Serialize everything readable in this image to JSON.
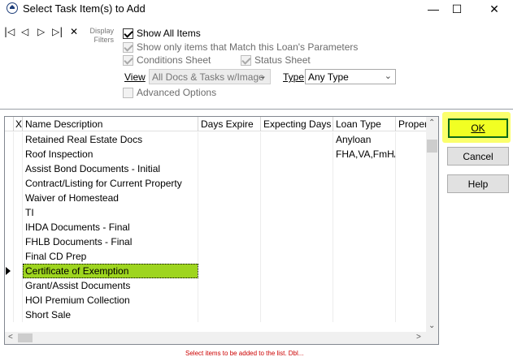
{
  "window": {
    "title": "Select Task Item(s) to Add",
    "minimize_glyph": "—",
    "maximize_glyph": "☐",
    "close_glyph": "✕"
  },
  "nav": {
    "first": "|◁",
    "prev": "◁",
    "next": "▷",
    "last": "▷|",
    "delete": "✕"
  },
  "filters": {
    "label": "Display Filters",
    "show_all": {
      "label": "Show All Items",
      "checked": true
    },
    "match_loan": {
      "label": "Show only items that Match this Loan's Parameters",
      "checked": true
    },
    "conditions_sheet": {
      "label": "Conditions Sheet",
      "checked": true
    },
    "status_sheet": {
      "label": "Status Sheet",
      "checked": true
    },
    "view_label": "View",
    "view_value": "All Docs & Tasks w/Image",
    "type_label": "Type",
    "type_value": "Any Type",
    "advanced": {
      "label": "Advanced Options",
      "checked": false
    }
  },
  "grid": {
    "columns": [
      "X",
      "Name Description",
      "Days Expire",
      "Expecting Days",
      "Loan Type",
      "Proper"
    ],
    "rows": [
      {
        "name": "Retained Real Estate Docs",
        "days_expire": "",
        "expecting_days": "",
        "loan_type": "Anyloan"
      },
      {
        "name": "Roof Inspection",
        "days_expire": "",
        "expecting_days": "",
        "loan_type": "FHA,VA,FmHA"
      },
      {
        "name": "Assist Bond Documents - Initial",
        "days_expire": "",
        "expecting_days": "",
        "loan_type": ""
      },
      {
        "name": "Contract/Listing for Current Property",
        "days_expire": "",
        "expecting_days": "",
        "loan_type": ""
      },
      {
        "name": "Waiver of Homestead",
        "days_expire": "",
        "expecting_days": "",
        "loan_type": ""
      },
      {
        "name": "TI",
        "days_expire": "",
        "expecting_days": "",
        "loan_type": ""
      },
      {
        "name": "IHDA Documents - Final",
        "days_expire": "",
        "expecting_days": "",
        "loan_type": ""
      },
      {
        "name": "FHLB Documents - Final",
        "days_expire": "",
        "expecting_days": "",
        "loan_type": ""
      },
      {
        "name": "Final CD Prep",
        "days_expire": "",
        "expecting_days": "",
        "loan_type": ""
      },
      {
        "name": "Certificate of Exemption",
        "days_expire": "",
        "expecting_days": "",
        "loan_type": ""
      },
      {
        "name": "Grant/Assist Documents",
        "days_expire": "",
        "expecting_days": "",
        "loan_type": ""
      },
      {
        "name": "HOI Premium Collection",
        "days_expire": "",
        "expecting_days": "",
        "loan_type": ""
      },
      {
        "name": "Short Sale",
        "days_expire": "",
        "expecting_days": "",
        "loan_type": ""
      }
    ],
    "selected_row": "Certificate of Exemption"
  },
  "buttons": {
    "ok": "OK",
    "cancel": "Cancel",
    "help": "Help"
  },
  "footer": {
    "status_text": "Select items to be added to the list. Dbl..."
  },
  "colors": {
    "highlight": "#9ed51f",
    "ok_button": "#f1ff23",
    "ok_border": "#0a6a17"
  }
}
